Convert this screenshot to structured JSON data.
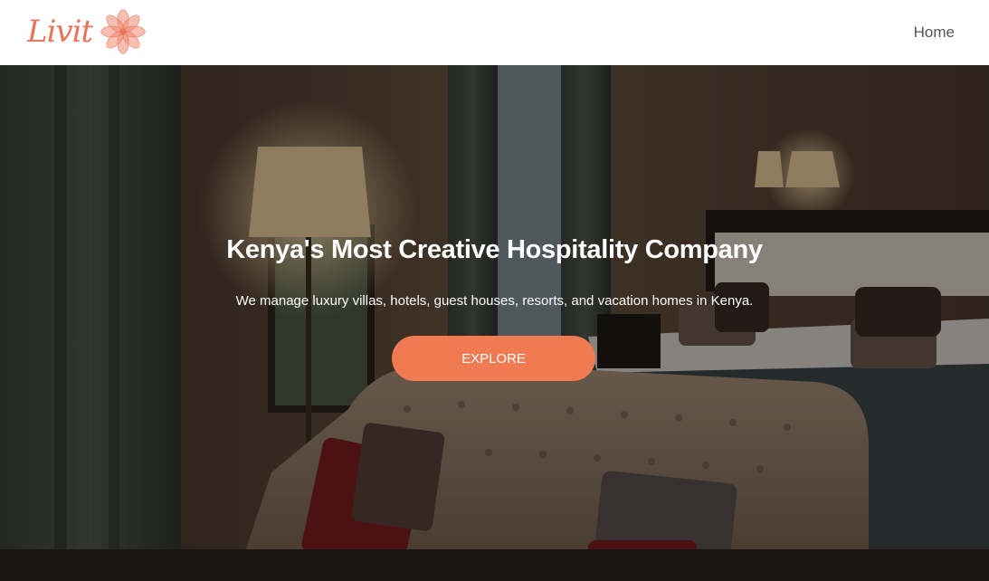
{
  "brand": {
    "logo_text": "Livit",
    "logo_icon": "lotus-flower-icon",
    "accent_color": "#f07a52",
    "logo_color": "#e8745a"
  },
  "nav": {
    "items": [
      {
        "label": "Home"
      }
    ]
  },
  "hero": {
    "background": "hotel-bedroom-photo",
    "title": "Kenya's Most Creative Hospitality Company",
    "subtitle": "We manage luxury villas, hotels, guest houses, resorts, and vacation homes in Kenya.",
    "cta_label": "EXPLORE"
  }
}
